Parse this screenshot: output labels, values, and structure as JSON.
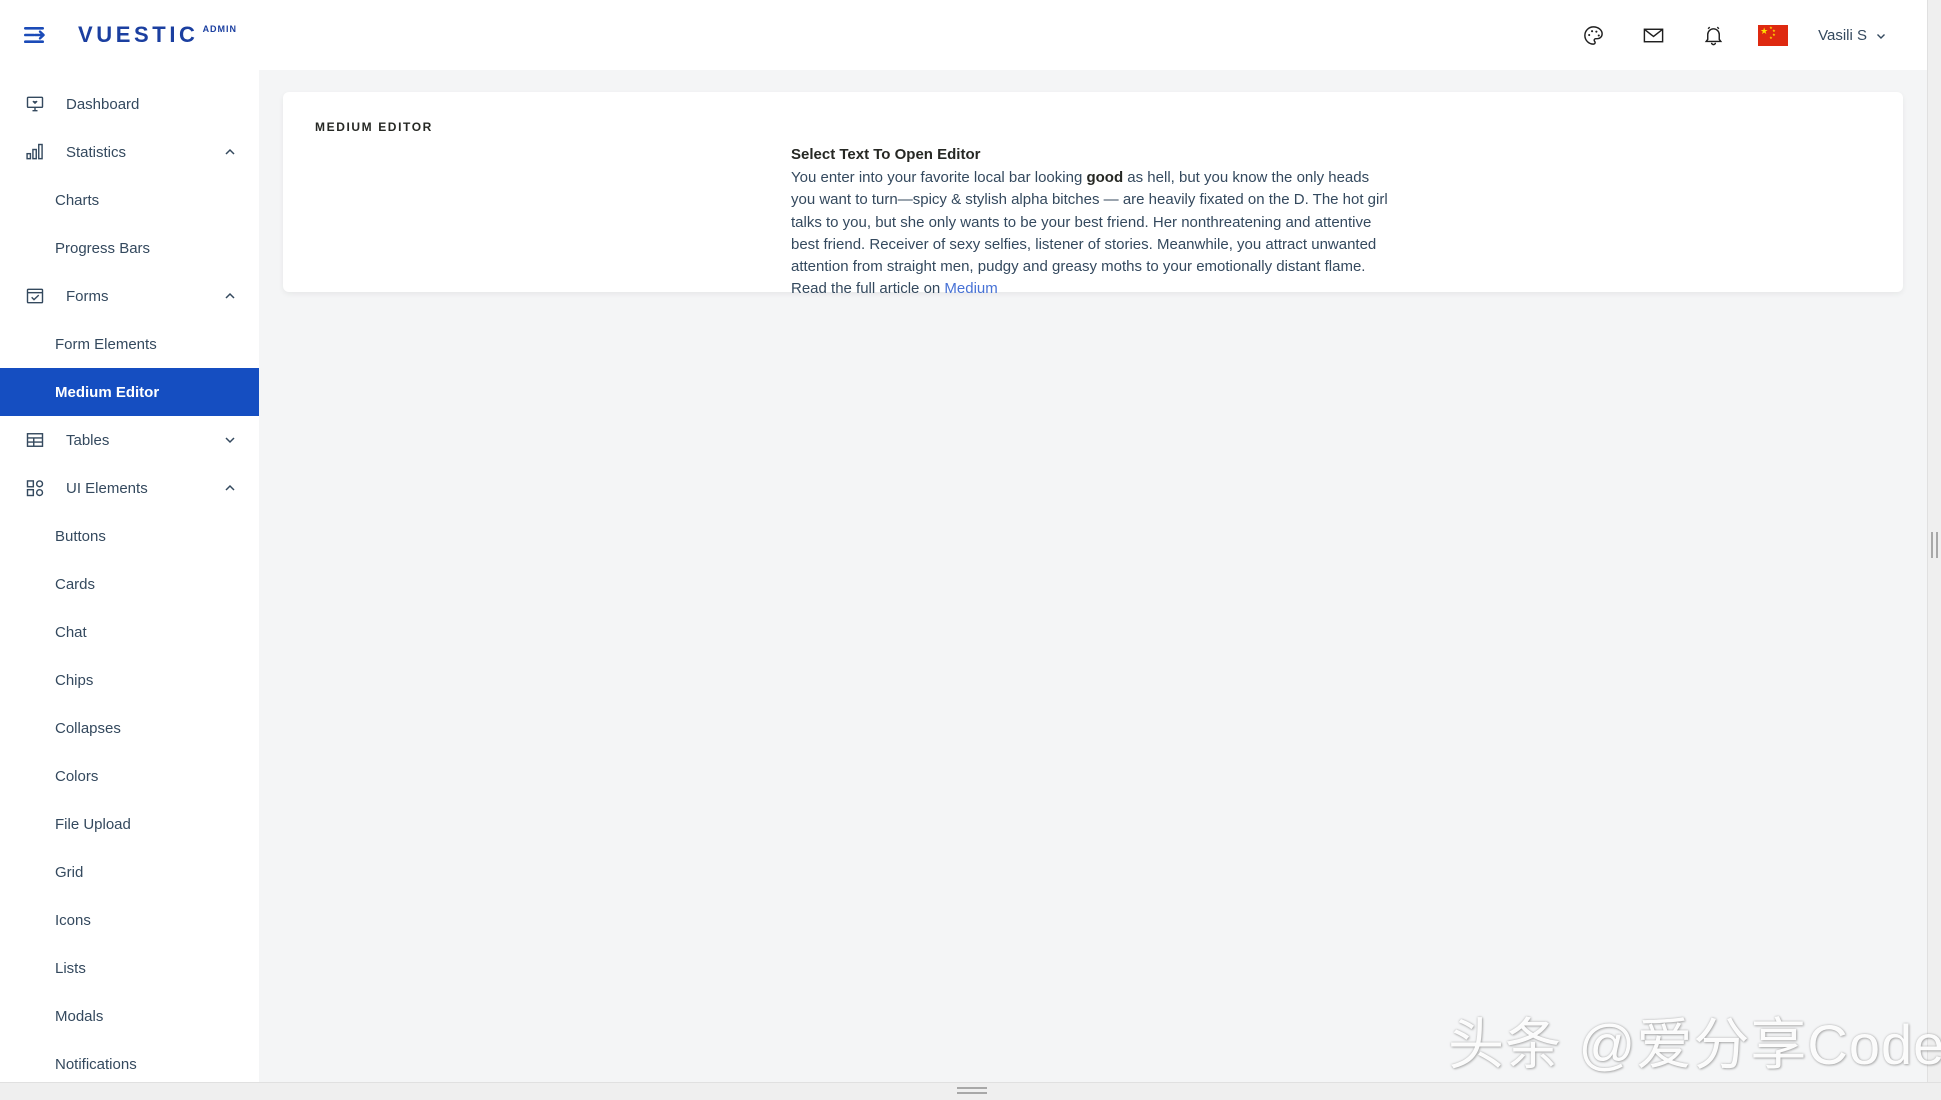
{
  "colors": {
    "brand_blue": "#1b3fa0",
    "active_blue": "#154ec1",
    "link_blue": "#4671d5",
    "text": "#34495e",
    "page_bg": "#f4f5f6",
    "flag_red": "#de2910",
    "flag_yellow": "#ffde00"
  },
  "header": {
    "menu_icon": "hamburger-arrow-icon",
    "brand": "VUESTIC",
    "brand_sub": "ADMIN",
    "icons": [
      {
        "name": "palette-icon",
        "label": "Theme"
      },
      {
        "name": "mail-icon",
        "label": "Messages"
      },
      {
        "name": "bell-icon",
        "label": "Notifications"
      }
    ],
    "language_flag": "china-flag-icon",
    "user_name": "Vasili S",
    "user_chevron": "chevron-down-icon"
  },
  "sidebar": {
    "items": [
      {
        "label": "Dashboard",
        "icon": "monitor-icon",
        "type": "item",
        "expandable": false,
        "active": false
      },
      {
        "label": "Statistics",
        "icon": "bar-chart-icon",
        "type": "group",
        "expandable": true,
        "expanded": true,
        "arrow": "chevron-up-icon"
      },
      {
        "label": "Charts",
        "type": "sub",
        "active": false
      },
      {
        "label": "Progress Bars",
        "type": "sub",
        "active": false
      },
      {
        "label": "Forms",
        "icon": "form-check-icon",
        "type": "group",
        "expandable": true,
        "expanded": true,
        "arrow": "chevron-up-icon"
      },
      {
        "label": "Form Elements",
        "type": "sub",
        "active": false
      },
      {
        "label": "Medium Editor",
        "type": "sub",
        "active": true
      },
      {
        "label": "Tables",
        "icon": "table-grid-icon",
        "type": "group",
        "expandable": true,
        "expanded": false,
        "arrow": "chevron-down-icon"
      },
      {
        "label": "UI Elements",
        "icon": "ui-elements-icon",
        "type": "group",
        "expandable": true,
        "expanded": true,
        "arrow": "chevron-up-icon"
      },
      {
        "label": "Buttons",
        "type": "sub",
        "active": false
      },
      {
        "label": "Cards",
        "type": "sub",
        "active": false
      },
      {
        "label": "Chat",
        "type": "sub",
        "active": false
      },
      {
        "label": "Chips",
        "type": "sub",
        "active": false
      },
      {
        "label": "Collapses",
        "type": "sub",
        "active": false
      },
      {
        "label": "Colors",
        "type": "sub",
        "active": false
      },
      {
        "label": "File Upload",
        "type": "sub",
        "active": false
      },
      {
        "label": "Grid",
        "type": "sub",
        "active": false
      },
      {
        "label": "Icons",
        "type": "sub",
        "active": false
      },
      {
        "label": "Lists",
        "type": "sub",
        "active": false
      },
      {
        "label": "Modals",
        "type": "sub",
        "active": false
      },
      {
        "label": "Notifications",
        "type": "sub",
        "active": false
      }
    ]
  },
  "main": {
    "card_title": "MEDIUM EDITOR",
    "editor": {
      "heading": "Select Text To Open Editor",
      "para_1a": "You enter into your favorite local bar looking ",
      "para_bold": "good",
      "para_1b": " as hell, but you know the only heads you want to turn—spicy & stylish alpha bitches — are heavily fixated on the D. The hot girl talks to you, but she only wants to be your best friend. Her nonthreatening and attentive best friend. Receiver of sexy selfies, listener of stories. Meanwhile, you attract unwanted attention from straight men, pudgy and greasy moths to your emotionally distant flame.",
      "para_2_prefix": "Read the full article on ",
      "link_label": "Medium"
    }
  },
  "watermark": {
    "text": "头条 @爱分享Coder"
  }
}
